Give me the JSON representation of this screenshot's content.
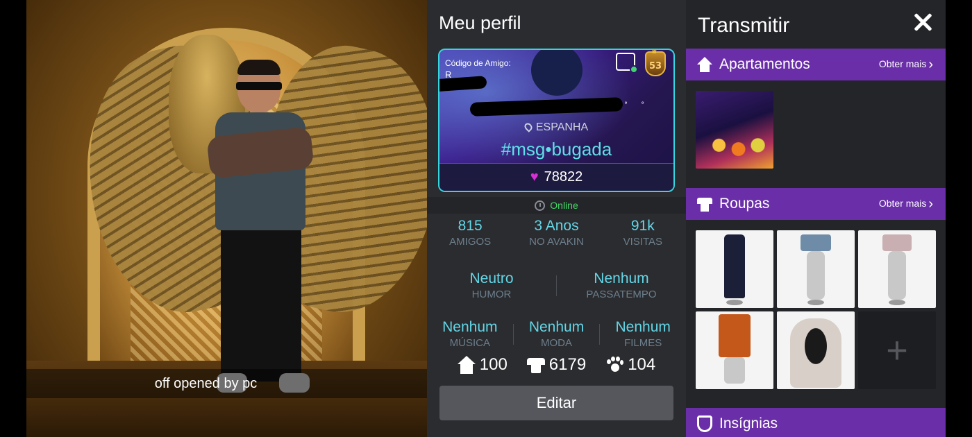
{
  "scene": {
    "caption": "off opened by pc"
  },
  "profile": {
    "title": "Meu perfil",
    "friend_code_label": "Código de Amigo:",
    "friend_code_value": "R",
    "level": "53",
    "location": "ESPANHA",
    "hashtag": "#msg•bugada",
    "likes": "78822",
    "status": "Online",
    "stats": [
      {
        "value": "815",
        "label": "AMIGOS"
      },
      {
        "value": "3 Anos",
        "label": "NO AVAKIN"
      },
      {
        "value": "91k",
        "label": "VISITAS"
      }
    ],
    "traits_row1": [
      {
        "value": "Neutro",
        "label": "HUMOR"
      },
      {
        "value": "Nenhum",
        "label": "PASSATEMPO"
      }
    ],
    "traits_row2": [
      {
        "value": "Nenhum",
        "label": "MÚSICA"
      },
      {
        "value": "Nenhum",
        "label": "MODA"
      },
      {
        "value": "Nenhum",
        "label": "FILMES"
      }
    ],
    "counts": {
      "homes": "100",
      "clothes": "6179",
      "pets": "104"
    },
    "edit_label": "Editar"
  },
  "panel": {
    "title": "Transmitir",
    "sections": {
      "apartments": {
        "label": "Apartamentos",
        "more": "Obter mais"
      },
      "clothes": {
        "label": "Roupas",
        "more": "Obter mais"
      },
      "badges": {
        "label": "Insígnias"
      }
    },
    "add_label": "+"
  },
  "colors": {
    "accent_purple": "#6a2fa8",
    "cyan": "#63d6e6",
    "online_green": "#48d66a",
    "heart": "#d82ed4"
  }
}
